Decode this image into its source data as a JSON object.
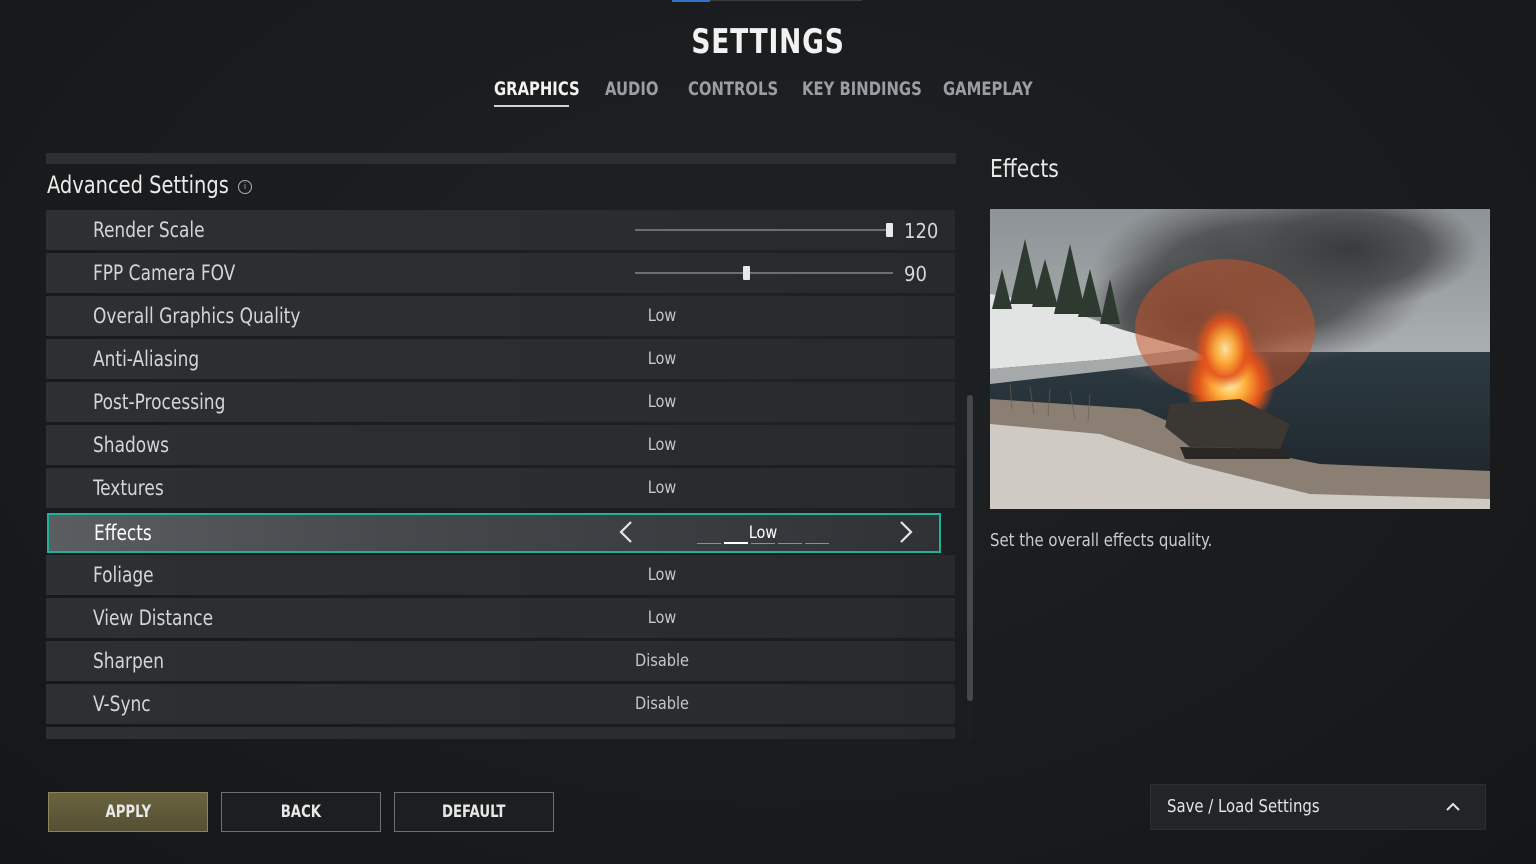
{
  "header": {
    "title": "SETTINGS",
    "tabs": [
      {
        "label": "GRAPHICS",
        "active": true
      },
      {
        "label": "AUDIO",
        "active": false
      },
      {
        "label": "CONTROLS",
        "active": false
      },
      {
        "label": "KEY BINDINGS",
        "active": false
      },
      {
        "label": "GAMEPLAY",
        "active": false
      }
    ]
  },
  "settings": {
    "section_title": "Advanced Settings",
    "info_icon": "i",
    "sliders": [
      {
        "label": "Render Scale",
        "value": "120",
        "fraction": 1.0
      },
      {
        "label": "FPP Camera FOV",
        "value": "90",
        "fraction": 0.43
      }
    ],
    "options": [
      {
        "label": "Overall Graphics Quality",
        "value": "Low"
      },
      {
        "label": "Anti-Aliasing",
        "value": "Low"
      },
      {
        "label": "Post-Processing",
        "value": "Low"
      },
      {
        "label": "Shadows",
        "value": "Low"
      },
      {
        "label": "Textures",
        "value": "Low"
      },
      {
        "label": "Effects",
        "value": "Low",
        "selected": true,
        "level": 2,
        "levels": 5
      },
      {
        "label": "Foliage",
        "value": "Low"
      },
      {
        "label": "View Distance",
        "value": "Low"
      },
      {
        "label": "Sharpen",
        "value": "Disable"
      },
      {
        "label": "V-Sync",
        "value": "Disable"
      }
    ]
  },
  "detail": {
    "title": "Effects",
    "description": "Set the overall effects quality."
  },
  "footer": {
    "apply": "APPLY",
    "back": "BACK",
    "default": "DEFAULT",
    "save_load": "Save / Load Settings"
  },
  "colors": {
    "accent_selected": "#1fb29a",
    "apply_button": "#6a6340",
    "tab_accent": "#2f73c9"
  }
}
